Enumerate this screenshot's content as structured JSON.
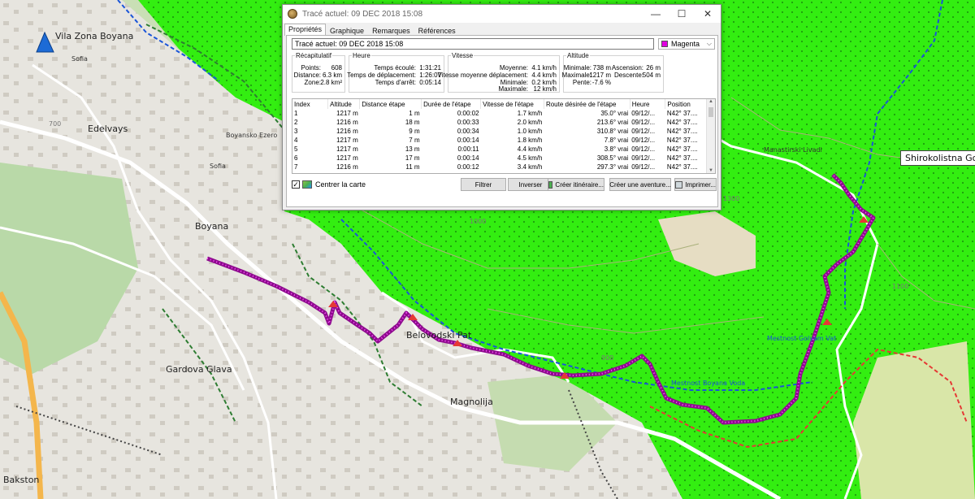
{
  "window": {
    "title": "Tracé actuel: 09 DEC 2018 15:08",
    "controls": {
      "minimize": "—",
      "maximize": "☐",
      "close": "✕"
    }
  },
  "tabs": [
    "Propriétés",
    "Graphique",
    "Remarques",
    "Références"
  ],
  "track": {
    "name": "Tracé actuel: 09 DEC 2018 15:08",
    "color": "Magenta",
    "color_hex": "#e000e0"
  },
  "summary": {
    "title": "Récapitulatif",
    "points_label": "Points:",
    "points": "608",
    "distance_label": "Distance:",
    "distance": "6.3 km",
    "zone_label": "Zone:",
    "zone": "2.8 km²"
  },
  "time": {
    "title": "Heure",
    "elapsed_label": "Temps écoulé:",
    "elapsed": "1:31:21",
    "moving_label": "Temps de déplacement:",
    "moving": "1:26:07",
    "stopped_label": "Temps d'arrêt:",
    "stopped": "0:05:14"
  },
  "speed": {
    "title": "Vitesse",
    "avg_label": "Moyenne:",
    "avg": "4.1 km/h",
    "avg_moving_label": "Vitesse moyenne déplacement:",
    "avg_moving": "4.4 km/h",
    "min_label": "Minimale:",
    "min": "0.2 km/h",
    "max_label": "Maximale:",
    "max": "12 km/h"
  },
  "altitude": {
    "title": "Altitude",
    "min_label": "Minimale:",
    "min": "738 m",
    "max_label": "Maximale:",
    "max": "1217 m",
    "slope_label": "Pente:",
    "slope": "-7.6 %",
    "ascent_label": "Ascension:",
    "ascent": "26 m",
    "descent_label": "Descente:",
    "descent": "504 m"
  },
  "table": {
    "headers": [
      "Index",
      "Altitude",
      "Distance étape",
      "Durée de l'étape",
      "Vitesse de l'étape",
      "Route désirée de l'étape",
      "Heure",
      "Position"
    ],
    "rows": [
      [
        "1",
        "1217 m",
        "1 m",
        "0:00:02",
        "1.7 km/h",
        "35.0° vrai",
        "09/12/...",
        "N42° 37...."
      ],
      [
        "2",
        "1216 m",
        "18 m",
        "0:00:33",
        "2.0 km/h",
        "213.6° vrai",
        "09/12/...",
        "N42° 37...."
      ],
      [
        "3",
        "1216 m",
        "9 m",
        "0:00:34",
        "1.0 km/h",
        "310.8° vrai",
        "09/12/...",
        "N42° 37...."
      ],
      [
        "4",
        "1217 m",
        "7 m",
        "0:00:14",
        "1.8 km/h",
        "7.8° vrai",
        "09/12/...",
        "N42° 37...."
      ],
      [
        "5",
        "1217 m",
        "13 m",
        "0:00:11",
        "4.4 km/h",
        "3.8° vrai",
        "09/12/...",
        "N42° 37...."
      ],
      [
        "6",
        "1217 m",
        "17 m",
        "0:00:14",
        "4.5 km/h",
        "308.5° vrai",
        "09/12/...",
        "N42° 37...."
      ],
      [
        "7",
        "1216 m",
        "11 m",
        "0:00:12",
        "3.4 km/h",
        "297.3° vrai",
        "09/12/...",
        "N42° 37...."
      ]
    ]
  },
  "center_map": {
    "label": "Centrer la carte",
    "checked": "✓"
  },
  "buttons": {
    "filter": "Filtrer",
    "invert": "Inverser",
    "create_route": "Créer itinéraire...",
    "create_adventure": "Créer une aventure...",
    "print": "Imprimer..."
  },
  "map": {
    "labels": {
      "vila_zona_boyana": "Vila Zona Boyana",
      "sofia1": "Sofia",
      "edelvays": "Edelvays",
      "sofia2": "Sofia",
      "boyana": "Boyana",
      "belovodski": "Belovodski Pat",
      "gardova_glava": "Gardova Glava",
      "magnolija": "Magnolija",
      "shirokolistna": "Shirokolistna Gora",
      "bakston": "Bakston",
      "mestnost": "Mestnost Boyana Voda",
      "mestnost2": "Mestnost Golyam Vat",
      "contour700": "700",
      "contour1000": "1000",
      "contour900": "900",
      "contour1100": "1100",
      "contour1300": "1300",
      "street1": "Boyansko Ezero",
      "street2": "Manastirski Livadi"
    }
  }
}
